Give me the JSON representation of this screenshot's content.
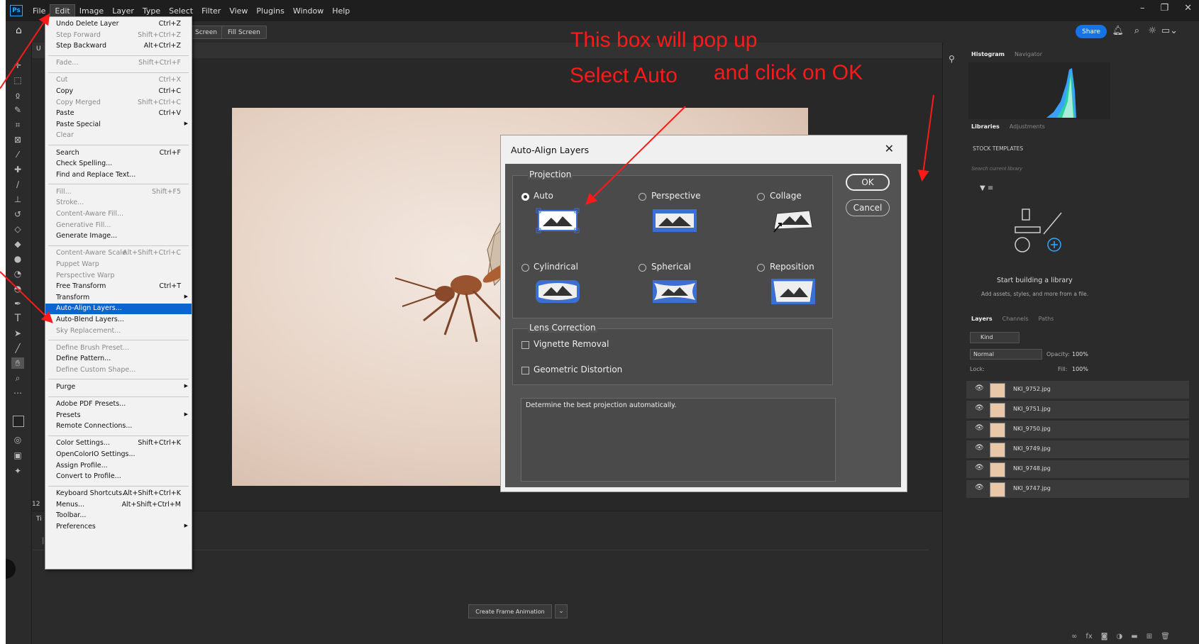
{
  "app": {
    "logo": "Ps"
  },
  "menubar": [
    "File",
    "Edit",
    "Image",
    "Layer",
    "Type",
    "Select",
    "Filter",
    "View",
    "Plugins",
    "Window",
    "Help"
  ],
  "window_controls": [
    "–",
    "❐",
    "✕"
  ],
  "options_bar": {
    "screen_label": "Screen",
    "fill_screen_label": "Fill Screen",
    "share_label": "Share"
  },
  "edit_menu": {
    "items": [
      {
        "label": "Undo Delete Layer",
        "shortcut": "Ctrl+Z",
        "disabled": false
      },
      {
        "label": "Step Forward",
        "shortcut": "Shift+Ctrl+Z",
        "disabled": true
      },
      {
        "label": "Step Backward",
        "shortcut": "Alt+Ctrl+Z",
        "disabled": false
      },
      {
        "sep": true
      },
      {
        "label": "Fade...",
        "shortcut": "Shift+Ctrl+F",
        "disabled": true
      },
      {
        "sep": true
      },
      {
        "label": "Cut",
        "shortcut": "Ctrl+X",
        "disabled": true
      },
      {
        "label": "Copy",
        "shortcut": "Ctrl+C",
        "disabled": false
      },
      {
        "label": "Copy Merged",
        "shortcut": "Shift+Ctrl+C",
        "disabled": true
      },
      {
        "label": "Paste",
        "shortcut": "Ctrl+V",
        "disabled": false
      },
      {
        "label": "Paste Special",
        "shortcut": "",
        "disabled": false,
        "submenu": true
      },
      {
        "label": "Clear",
        "shortcut": "",
        "disabled": true
      },
      {
        "sep": true
      },
      {
        "label": "Search",
        "shortcut": "Ctrl+F",
        "disabled": false
      },
      {
        "label": "Check Spelling...",
        "shortcut": "",
        "disabled": false
      },
      {
        "label": "Find and Replace Text...",
        "shortcut": "",
        "disabled": false
      },
      {
        "sep": true
      },
      {
        "label": "Fill...",
        "shortcut": "Shift+F5",
        "disabled": true
      },
      {
        "label": "Stroke...",
        "shortcut": "",
        "disabled": true
      },
      {
        "label": "Content-Aware Fill...",
        "shortcut": "",
        "disabled": true
      },
      {
        "label": "Generative Fill...",
        "shortcut": "",
        "disabled": true
      },
      {
        "label": "Generate Image...",
        "shortcut": "",
        "disabled": false
      },
      {
        "sep": true
      },
      {
        "label": "Content-Aware Scale",
        "shortcut": "Alt+Shift+Ctrl+C",
        "disabled": true
      },
      {
        "label": "Puppet Warp",
        "shortcut": "",
        "disabled": true
      },
      {
        "label": "Perspective Warp",
        "shortcut": "",
        "disabled": true
      },
      {
        "label": "Free Transform",
        "shortcut": "Ctrl+T",
        "disabled": false
      },
      {
        "label": "Transform",
        "shortcut": "",
        "disabled": false,
        "submenu": true
      },
      {
        "label": "Auto-Align Layers...",
        "shortcut": "",
        "disabled": false,
        "highlight": true
      },
      {
        "label": "Auto-Blend Layers...",
        "shortcut": "",
        "disabled": false
      },
      {
        "label": "Sky Replacement...",
        "shortcut": "",
        "disabled": true
      },
      {
        "sep": true
      },
      {
        "label": "Define Brush Preset...",
        "shortcut": "",
        "disabled": true
      },
      {
        "label": "Define Pattern...",
        "shortcut": "",
        "disabled": false
      },
      {
        "label": "Define Custom Shape...",
        "shortcut": "",
        "disabled": true
      },
      {
        "sep": true
      },
      {
        "label": "Purge",
        "shortcut": "",
        "disabled": false,
        "submenu": true
      },
      {
        "sep": true
      },
      {
        "label": "Adobe PDF Presets...",
        "shortcut": "",
        "disabled": false
      },
      {
        "label": "Presets",
        "shortcut": "",
        "disabled": false,
        "submenu": true
      },
      {
        "label": "Remote Connections...",
        "shortcut": "",
        "disabled": false
      },
      {
        "sep": true
      },
      {
        "label": "Color Settings...",
        "shortcut": "Shift+Ctrl+K",
        "disabled": false
      },
      {
        "label": "OpenColorIO Settings...",
        "shortcut": "",
        "disabled": false
      },
      {
        "label": "Assign Profile...",
        "shortcut": "",
        "disabled": false
      },
      {
        "label": "Convert to Profile...",
        "shortcut": "",
        "disabled": false
      },
      {
        "sep": true
      },
      {
        "label": "Keyboard Shortcuts...",
        "shortcut": "Alt+Shift+Ctrl+K",
        "disabled": false
      },
      {
        "label": "Menus...",
        "shortcut": "Alt+Shift+Ctrl+M",
        "disabled": false
      },
      {
        "label": "Toolbar...",
        "shortcut": "",
        "disabled": false
      },
      {
        "label": "Preferences",
        "shortcut": "",
        "disabled": false,
        "submenu": true
      }
    ]
  },
  "dialog": {
    "title": "Auto-Align Layers",
    "close": "✕",
    "projection_label": "Projection",
    "projections": [
      "Auto",
      "Perspective",
      "Collage",
      "Cylindrical",
      "Spherical",
      "Reposition"
    ],
    "selected": "Auto",
    "lens_label": "Lens Correction",
    "lens_options": [
      "Vignette Removal",
      "Geometric Distortion"
    ],
    "description": "Determine the best projection automatically.",
    "ok": "OK",
    "cancel": "Cancel"
  },
  "annotations": {
    "popup": "This box will pop up",
    "select_auto": "Select Auto",
    "click_ok": "and click on OK"
  },
  "right_panel": {
    "histogram_tabs": [
      "Histogram",
      "Navigator"
    ],
    "library_tabs": [
      "Libraries",
      "Adjustments"
    ],
    "stock_templates": "STOCK TEMPLATES",
    "search_placeholder": "Search current library",
    "library_heading": "Start building a library",
    "library_sub": "Add assets, styles, and more from a file.",
    "layers_tabs": [
      "Layers",
      "Channels",
      "Paths"
    ],
    "kind": "Kind",
    "blend_mode": "Normal",
    "opacity_label": "Opacity:",
    "opacity": "100%",
    "lock_label": "Lock:",
    "fill_label": "Fill:",
    "fill": "100%",
    "layers": [
      "NKI_9752.jpg",
      "NKI_9751.jpg",
      "NKI_9750.jpg",
      "NKI_9749.jpg",
      "NKI_9748.jpg",
      "NKI_9747.jpg"
    ]
  },
  "timeline": {
    "create_frame_animation": "Create Frame Animation"
  },
  "doc": {
    "zoom_prefix": "12",
    "tab_prefix": "U",
    "timeline_prefix": "Ti"
  },
  "colors": {
    "accent": "#0a64d2",
    "share": "#1473e6",
    "annotation": "#ff1a1a"
  }
}
